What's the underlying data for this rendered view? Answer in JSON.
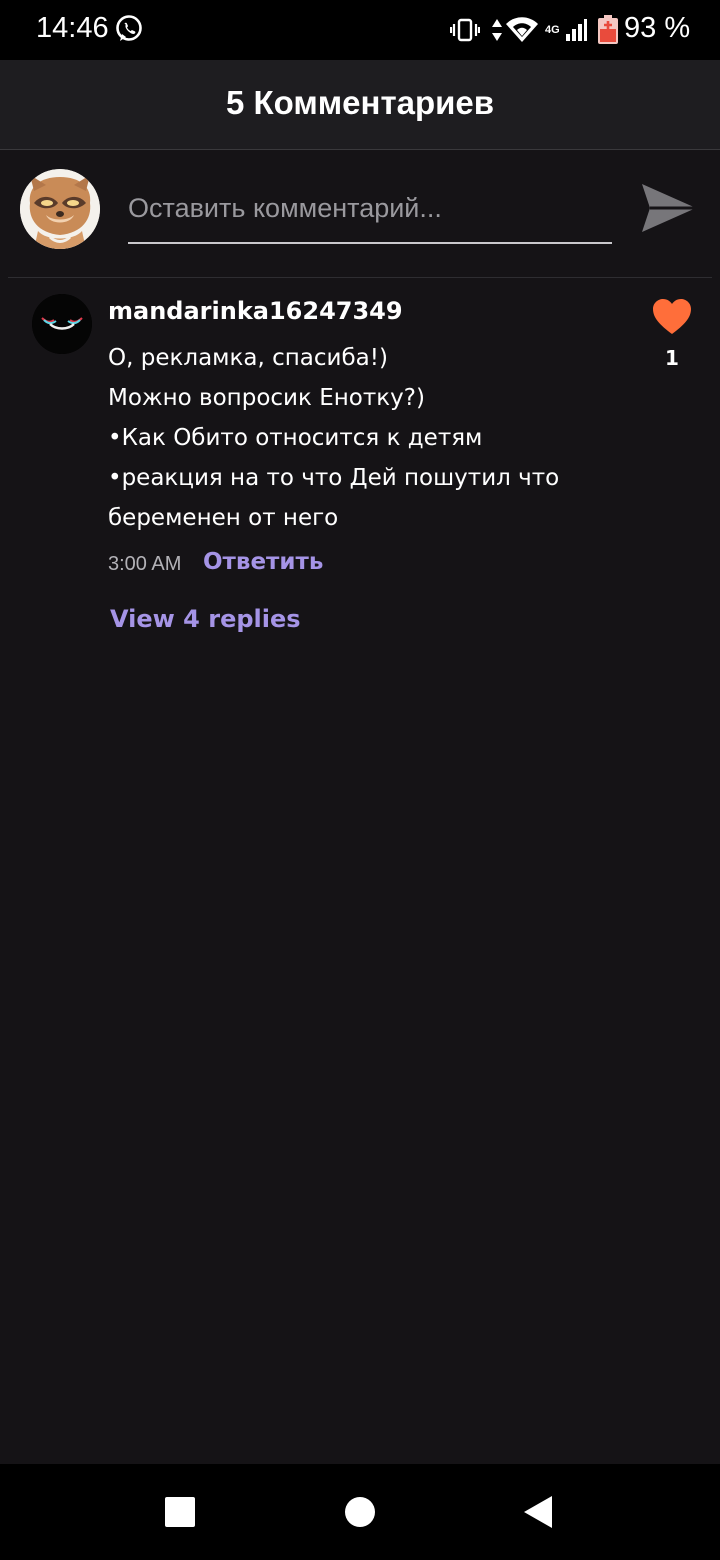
{
  "status_bar": {
    "time": "14:46",
    "network": "4G",
    "battery": "93 %",
    "icons": [
      "whatsapp-icon",
      "vibrate-icon",
      "data-arrows-icon",
      "wifi-icon",
      "signal-icon",
      "battery-icon"
    ]
  },
  "header": {
    "title": "5 Комментариев"
  },
  "compose": {
    "placeholder": "Оставить комментарий...",
    "send_icon": "send-icon"
  },
  "comments": [
    {
      "username": "mandarinka16247349",
      "lines": [
        "О, рекламка, спасиба!)",
        "Можно вопросик Енотку?)",
        "•Как Обито относится к детям",
        "•реакция на то что Дей пошутил что",
        "беременен от него"
      ],
      "time": "3:00 AM",
      "reply_label": "Ответить",
      "view_replies_label": "View 4 replies",
      "likes": "1"
    }
  ],
  "colors": {
    "background": "#151316",
    "header": "#1e1d20",
    "accent": "#a594e6",
    "like": "#ff6e3a"
  }
}
